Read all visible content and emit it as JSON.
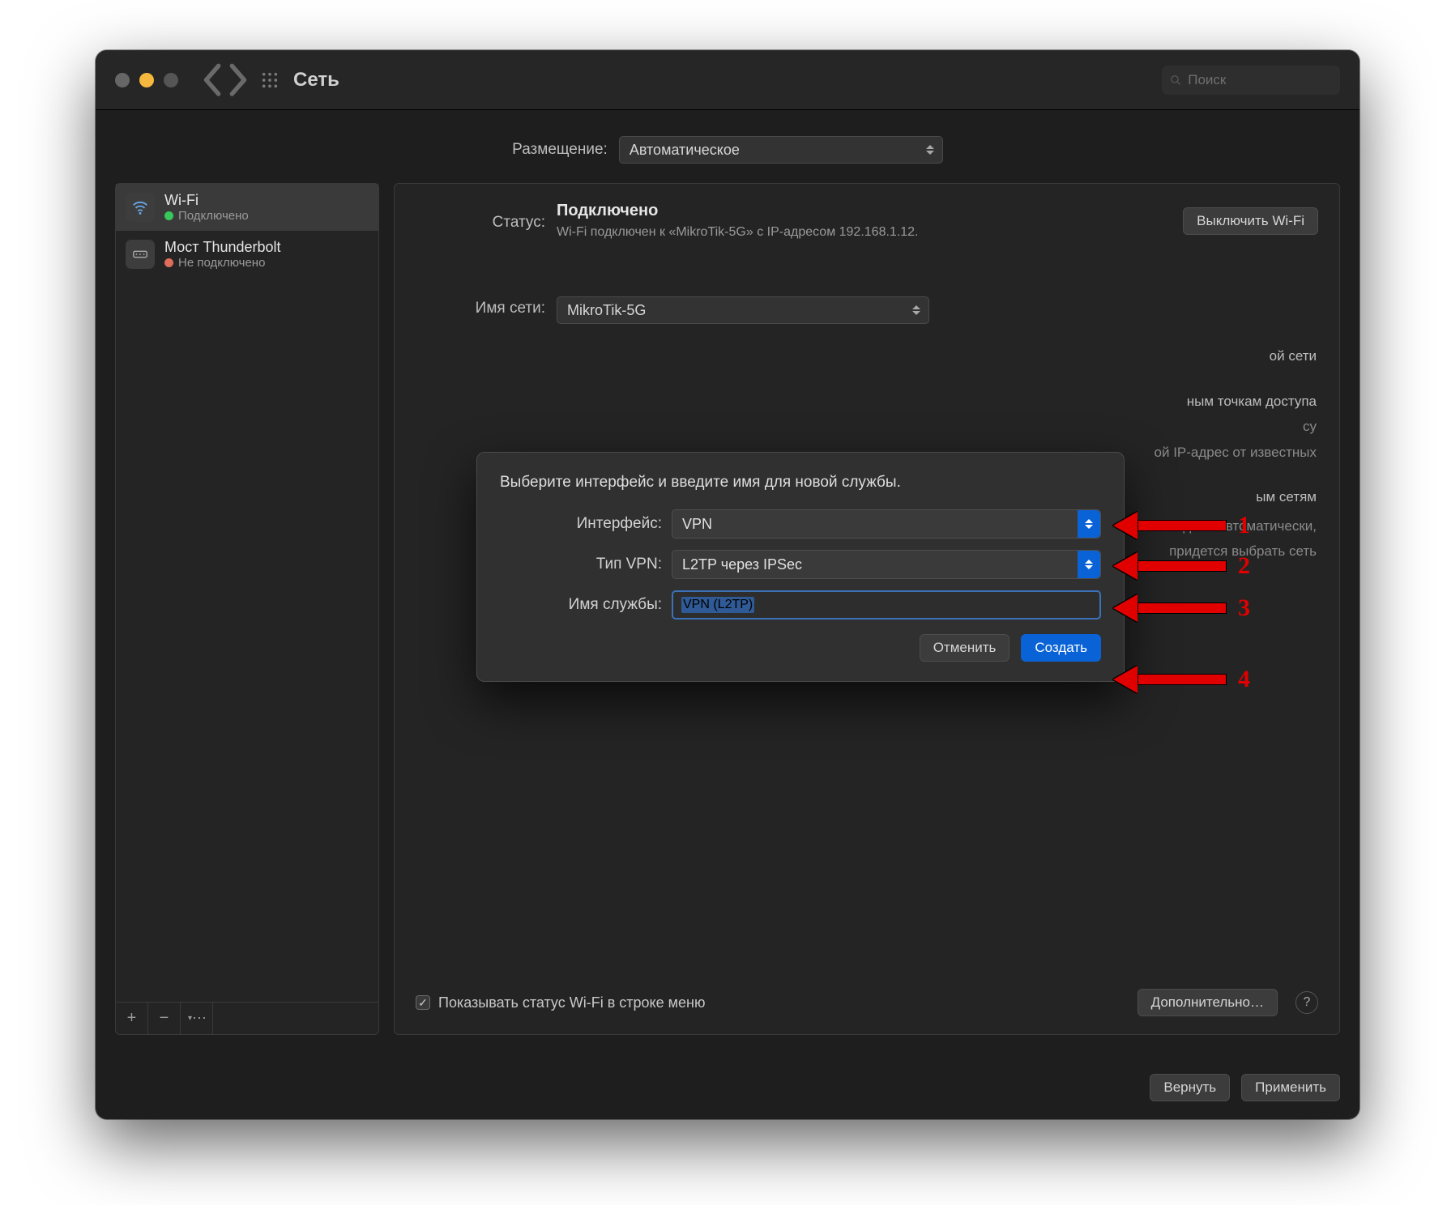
{
  "window": {
    "title": "Сеть",
    "search_placeholder": "Поиск"
  },
  "location": {
    "label": "Размещение:",
    "value": "Автоматическое"
  },
  "sidebar": {
    "items": [
      {
        "name": "Wi-Fi",
        "status": "Подключено",
        "dot": "green"
      },
      {
        "name": "Мост Thunderbolt",
        "status": "Не подключено",
        "dot": "red"
      }
    ],
    "add": "+",
    "remove": "−"
  },
  "main": {
    "status_label": "Статус:",
    "status_value": "Подключено",
    "status_sub": "Wi-Fi подключен к «MikroTik-5G» с IP-адресом 192.168.1.12.",
    "wifi_off_btn": "Выключить Wi-Fi",
    "netname_label": "Имя сети:",
    "netname_value": "MikroTik-5G",
    "bg_lines": [
      "ой сети",
      "ным точкам доступа",
      "су",
      "ой IP-адрес от известных",
      "ым сетям",
      "дено автоматически,",
      "придется выбрать сеть"
    ],
    "show_status_label": "Показывать статус Wi-Fi в строке меню",
    "advanced_btn": "Дополнительно…"
  },
  "footer": {
    "revert": "Вернуть",
    "apply": "Применить"
  },
  "sheet": {
    "message": "Выберите интерфейс и введите имя для новой службы.",
    "interface_label": "Интерфейс:",
    "interface_value": "VPN",
    "vpntype_label": "Тип VPN:",
    "vpntype_value": "L2TP через IPSec",
    "service_label": "Имя службы:",
    "service_value": "VPN (L2TP)",
    "cancel": "Отменить",
    "create": "Создать"
  },
  "annotations": {
    "n1": "1",
    "n2": "2",
    "n3": "3",
    "n4": "4"
  }
}
